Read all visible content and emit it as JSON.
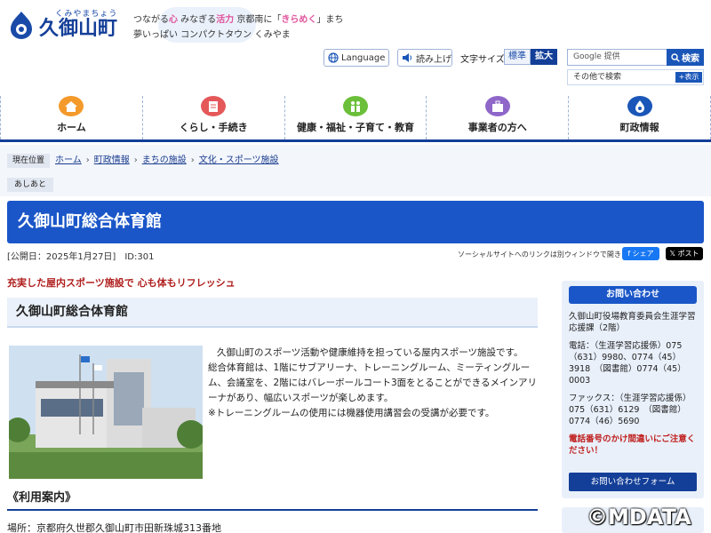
{
  "header": {
    "logo_kana": "くみやまちょう",
    "logo_kanji": "久御山町",
    "slogan_line1_a": "つながる",
    "slogan_line1_b": "心",
    "slogan_line1_c": " みなぎる",
    "slogan_line1_d": "活力",
    "slogan_line1_e": " 京都南に「",
    "slogan_line1_f": "きらめく",
    "slogan_line1_g": "」まち",
    "slogan_line2": "夢いっぱい コンパクトタウン くみやま",
    "language_label": "Language",
    "read_aloud_label": "読み上げ",
    "font_size_label": "文字サイズ",
    "font_normal": "標準",
    "font_large": "拡大",
    "search_placeholder": "Google 提供",
    "search_button": "検索",
    "other_search_label": "その他で検索",
    "other_search_show": "表示"
  },
  "gnav": [
    {
      "label": "ホーム",
      "color": "#f39a2b",
      "icon": "home-icon"
    },
    {
      "label": "くらし・手続き",
      "color": "#e4585a",
      "icon": "document-icon"
    },
    {
      "label": "健康・福祉・子育て・教育",
      "color": "#6cbf3a",
      "icon": "family-icon"
    },
    {
      "label": "事業者の方へ",
      "color": "#8f67c9",
      "icon": "business-icon"
    },
    {
      "label": "町政情報",
      "color": "#1a56b8",
      "icon": "town-emblem-icon"
    }
  ],
  "breadcrumb": {
    "current_label": "現在位置",
    "items": [
      "ホーム",
      "町政情報",
      "まちの施設",
      "文化・スポーツ施設"
    ],
    "sub": "あしあと"
  },
  "page": {
    "title": "久御山町総合体育館",
    "published": "[公開日：2025年1月27日]",
    "id": "ID:301",
    "social_note": "ソーシャルサイトへのリンクは別ウィンドウで開きます",
    "share": "シェア",
    "post": "ポスト"
  },
  "main": {
    "lead": "充実した屋内スポーツ施設で 心も体もリフレッシュ",
    "section_title": "久御山町総合体育館",
    "desc1": "久御山町のスポーツ活動や健康維持を担っている屋内スポーツ施設です。",
    "desc2": "総合体育館は、1階にサブアリーナ、トレーニングルーム、ミーティングルーム、会議室を、2階にはバレーボールコート3面をとることができるメインアリーナがあり、幅広いスポーツが楽しめます。",
    "desc3": "※トレーニングルームの使用には機器使用講習会の受講が必要です。",
    "usage_title": "《利用案内》",
    "address": "場所：京都府久世郡久御山町市田新珠城313番地"
  },
  "sidebar": {
    "head": "お問い合わせ",
    "dept": "久御山町役場教育委員会生涯学習応援課（2階）",
    "tel": "電話：（生涯学習応援係）075（631）9980、0774（45）3918　（図書館）0774（45）0003",
    "fax": "ファックス：（生涯学習応援係）075（631）6129　（図書館）0774（46）5690",
    "warn": "電話番号のかけ間違いにご注意ください！",
    "form": "お問い合わせフォーム"
  },
  "watermark": "©MDATA"
}
